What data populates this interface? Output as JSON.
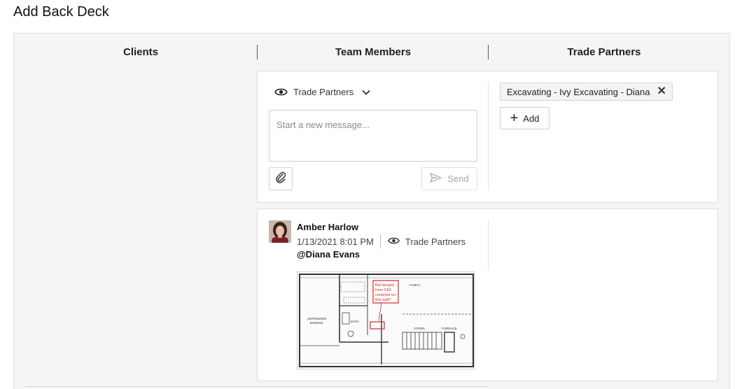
{
  "page": {
    "title": "Add Back Deck"
  },
  "columns": {
    "clients": "Clients",
    "team_members": "Team Members",
    "trade_partners": "Trade Partners"
  },
  "composer": {
    "visibility_label": "Trade Partners",
    "message_placeholder": "Start a new message...",
    "send_label": "Send",
    "icons": {
      "visibility": "eye-icon",
      "dropdown": "chevron-down-icon",
      "attach": "paperclip-icon",
      "send": "send-icon"
    }
  },
  "recipients": {
    "tags": [
      {
        "label": "Excavating - Ivy Excavating - Diana"
      }
    ],
    "add_label": "Add"
  },
  "message": {
    "author": "Amber Harlow",
    "timestamp": "1/13/2021 8:01 PM",
    "visibility_label": "Trade Partners",
    "mention": "@Diana Evans",
    "attachment": {
      "annotation_lines": [
        "Bar bought",
        "from CKF",
        "centered on",
        "this wall?"
      ],
      "room_labels": [
        "UNFINISHED",
        "EGRESS",
        "FAMILY",
        "BATH",
        "FURNACE",
        "STAIRS"
      ]
    }
  },
  "colors": {
    "accent_red": "#d12a2a",
    "text": "#222222",
    "muted": "#8a8a8a",
    "panel_bg": "#f5f5f5"
  }
}
